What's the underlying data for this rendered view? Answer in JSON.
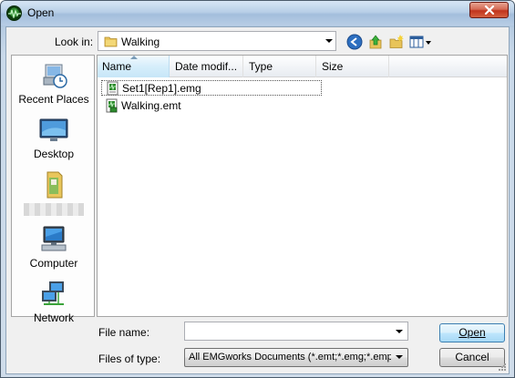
{
  "window": {
    "title": "Open",
    "icons": {
      "app": "emgworks-app-icon",
      "close": "close-icon"
    }
  },
  "lookin": {
    "label": "Look in:",
    "value": "Walking",
    "icon": "folder-icon",
    "toolbar_icons": [
      "back-icon",
      "up-folder-icon",
      "new-folder-icon",
      "view-menu-icon"
    ]
  },
  "places": [
    {
      "label": "Recent Places",
      "icon": "recent-places-icon"
    },
    {
      "label": "Desktop",
      "icon": "desktop-icon"
    },
    {
      "label": "",
      "icon": "user-folder-icon"
    },
    {
      "label": "Computer",
      "icon": "computer-icon"
    },
    {
      "label": "Network",
      "icon": "network-icon"
    }
  ],
  "columns": [
    "Name",
    "Date modif...",
    "Type",
    "Size"
  ],
  "sorted_column": "Name",
  "files": [
    {
      "name": "Set1[Rep1].emg",
      "icon": "emg-file-icon"
    },
    {
      "name": "Walking.emt",
      "icon": "emt-file-icon"
    }
  ],
  "filename": {
    "label": "File name:",
    "value": ""
  },
  "filetype": {
    "label": "Files of type:",
    "value": "All EMGworks Documents (*.emt;*.emg;*.emp;*."
  },
  "buttons": {
    "open": "Open",
    "cancel": "Cancel"
  },
  "colors": {
    "title_gradient_top": "#d7e6f5",
    "close_red": "#c0341c",
    "selection_blue": "#d6eefb"
  }
}
